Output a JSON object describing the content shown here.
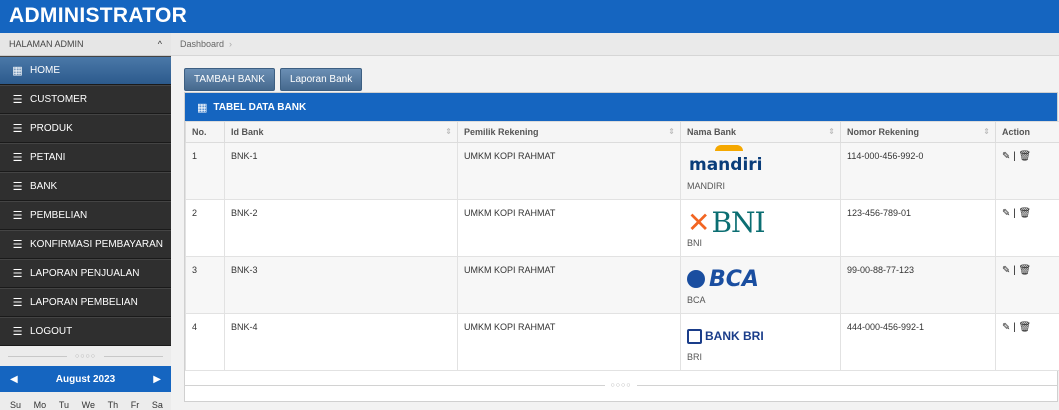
{
  "header": {
    "title": "ADMINISTRATOR"
  },
  "sidebar": {
    "section_label": "HALAMAN ADMIN",
    "items": [
      {
        "label": "HOME",
        "icon": "grid-icon",
        "active": true
      },
      {
        "label": "CUSTOMER",
        "icon": "list-icon"
      },
      {
        "label": "PRODUK",
        "icon": "list-icon"
      },
      {
        "label": "PETANI",
        "icon": "list-icon"
      },
      {
        "label": "BANK",
        "icon": "list-icon"
      },
      {
        "label": "PEMBELIAN",
        "icon": "list-icon"
      },
      {
        "label": "KONFIRMASI PEMBAYARAN",
        "icon": "list-icon"
      },
      {
        "label": "LAPORAN PENJUALAN",
        "icon": "list-icon"
      },
      {
        "label": "LAPORAN PEMBELIAN",
        "icon": "list-icon"
      },
      {
        "label": "LOGOUT",
        "icon": "list-icon"
      }
    ],
    "calendar": {
      "month": "August 2023",
      "days": [
        "Su",
        "Mo",
        "Tu",
        "We",
        "Th",
        "Fr",
        "Sa"
      ]
    }
  },
  "breadcrumb": {
    "item": "Dashboard"
  },
  "buttons": {
    "add_bank": "TAMBAH BANK",
    "bank_report": "Laporan Bank"
  },
  "panel": {
    "title": "TABEL DATA BANK",
    "columns": [
      "No.",
      "Id Bank",
      "Pemilik Rekening",
      "Nama Bank",
      "Nomor Rekening",
      "Action"
    ],
    "rows": [
      {
        "no": "1",
        "id": "BNK-1",
        "owner": "UMKM KOPI RAHMAT",
        "logo": "mandiri",
        "bank": "MANDIRI",
        "account": "114-000-456-992-0"
      },
      {
        "no": "2",
        "id": "BNK-2",
        "owner": "UMKM KOPI RAHMAT",
        "logo": "BNI",
        "bank": "BNI",
        "account": "123-456-789-01"
      },
      {
        "no": "3",
        "id": "BNK-3",
        "owner": "UMKM KOPI RAHMAT",
        "logo": "BCA",
        "bank": "BCA",
        "account": "99-00-88-77-123"
      },
      {
        "no": "4",
        "id": "BNK-4",
        "owner": "UMKM KOPI RAHMAT",
        "logo": "BANK BRI",
        "bank": "BRI",
        "account": "444-000-456-992-1"
      }
    ]
  },
  "colors": {
    "primary": "#1565c0",
    "sidebar_bg": "#2f2f2f",
    "active_item": "#3a6a9c"
  }
}
